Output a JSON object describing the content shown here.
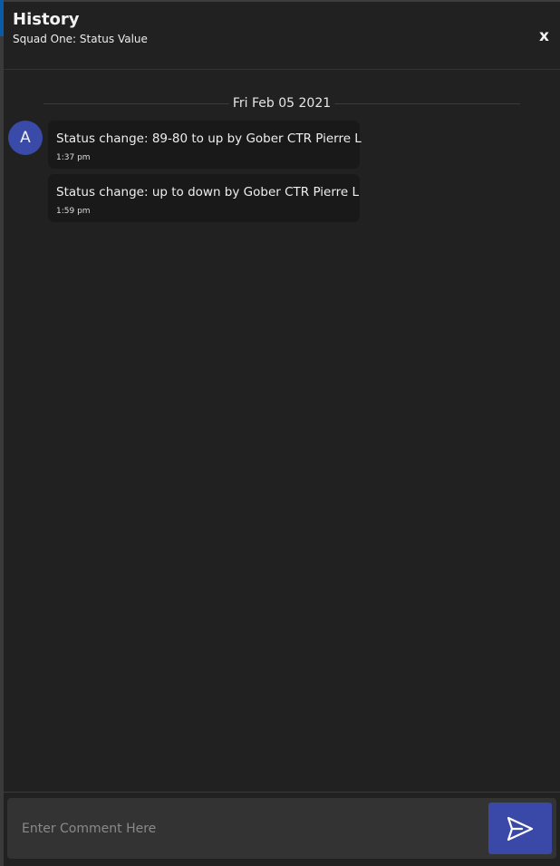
{
  "header": {
    "title": "History",
    "subtitle": "Squad One: Status Value",
    "close_label": "x"
  },
  "timeline": {
    "date": "Fri Feb 05 2021",
    "avatar_initial": "A",
    "messages": [
      {
        "text": "Status change: 89-80 to up by Gober CTR Pierre L",
        "time": "1:37 pm"
      },
      {
        "text": "Status change: up to down by Gober CTR Pierre L",
        "time": "1:59 pm"
      }
    ]
  },
  "composer": {
    "placeholder": "Enter Comment Here",
    "value": "",
    "send_icon": "send-icon"
  },
  "colors": {
    "background": "#212121",
    "bubble": "#191919",
    "accent": "#3a48a7",
    "avatar": "#3a4aa8"
  }
}
